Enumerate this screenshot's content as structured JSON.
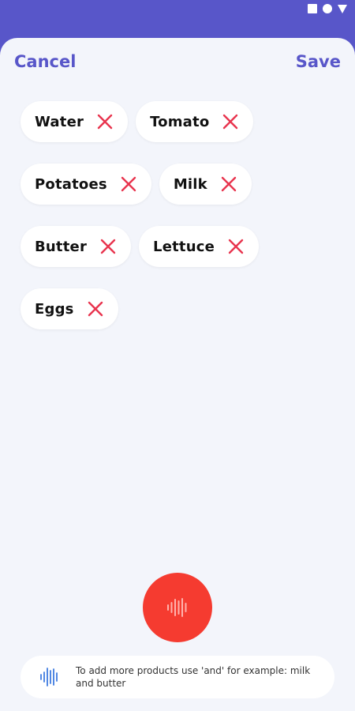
{
  "header": {
    "cancel_label": "Cancel",
    "save_label": "Save"
  },
  "chips": [
    {
      "label": "Water"
    },
    {
      "label": "Tomato"
    },
    {
      "label": "Potatoes"
    },
    {
      "label": "Milk"
    },
    {
      "label": "Butter"
    },
    {
      "label": "Lettuce"
    },
    {
      "label": "Eggs"
    }
  ],
  "hint": {
    "text": "To add more products use 'and' for example: milk and butter"
  },
  "icons": {
    "remove": "close-icon",
    "mic": "sound-wave-icon",
    "hint": "sound-wave-icon"
  },
  "colors": {
    "accent": "#5856c9",
    "mic": "#f53b30",
    "remove": "#e8344e",
    "hint_icon": "#3e7be0",
    "background": "#f3f5fb"
  }
}
